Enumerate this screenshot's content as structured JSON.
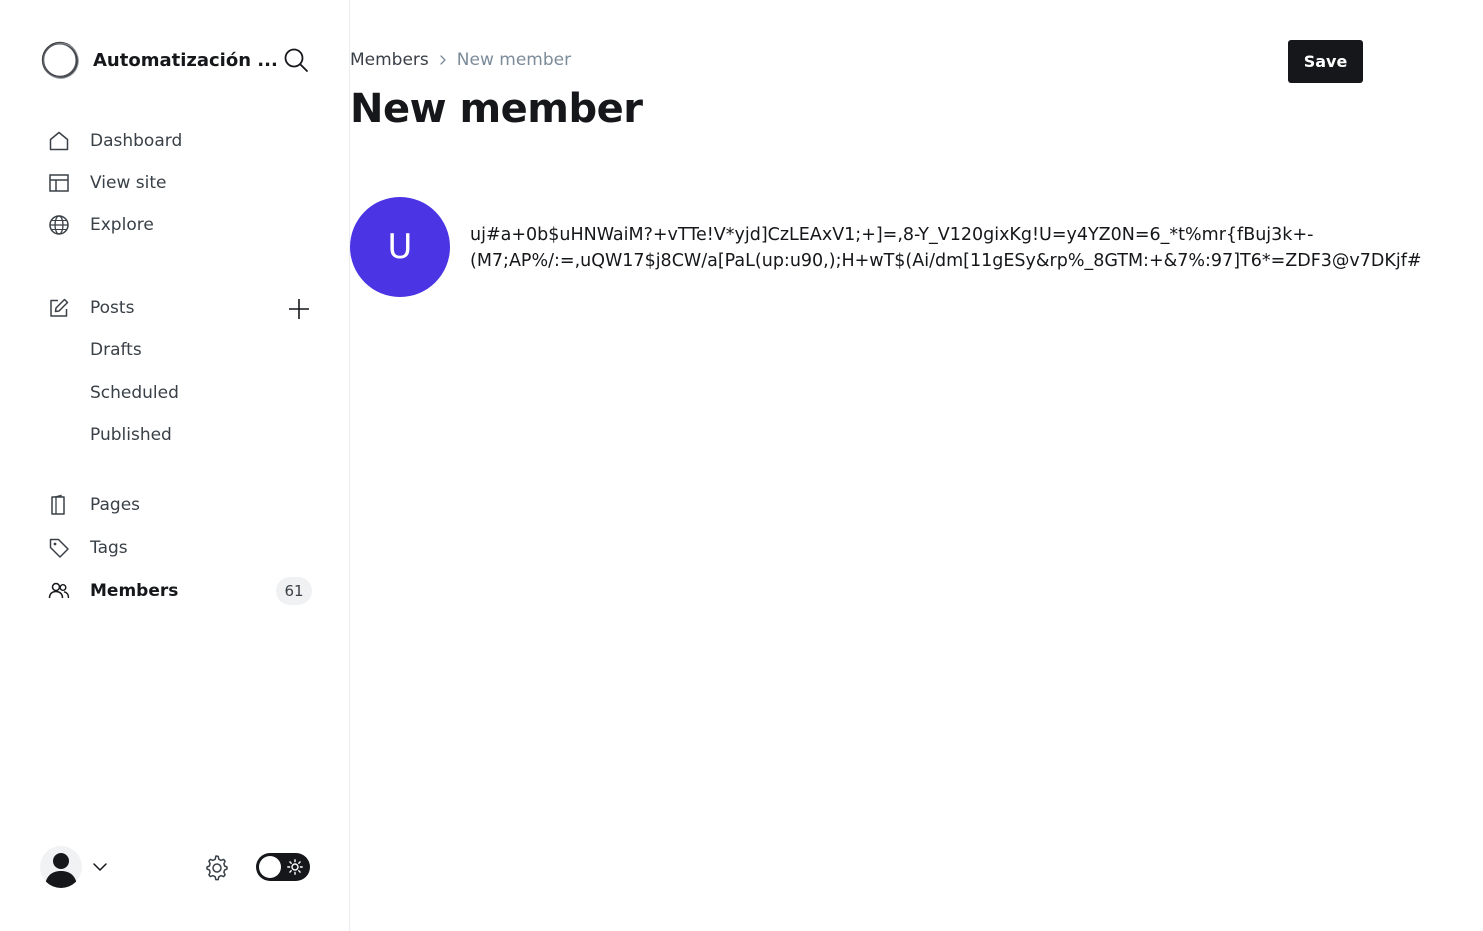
{
  "sidebar": {
    "brand": {
      "name": "Automatización ...",
      "logo_icon": "circle-logo-icon"
    },
    "search_icon": "search-icon",
    "nav": {
      "dashboard": {
        "label": "Dashboard",
        "icon": "home-icon"
      },
      "view_site": {
        "label": "View site",
        "icon": "layout-icon"
      },
      "explore": {
        "label": "Explore",
        "icon": "globe-icon"
      },
      "posts": {
        "label": "Posts",
        "icon": "edit-icon",
        "add_icon": "plus-icon"
      },
      "drafts": {
        "label": "Drafts"
      },
      "scheduled": {
        "label": "Scheduled"
      },
      "published": {
        "label": "Published"
      },
      "pages": {
        "label": "Pages",
        "icon": "page-icon"
      },
      "tags": {
        "label": "Tags",
        "icon": "tag-icon"
      },
      "members": {
        "label": "Members",
        "icon": "users-icon",
        "count": "61",
        "active": true
      }
    },
    "footer": {
      "avatar_icon": "user-avatar-icon",
      "chevron_icon": "chevron-down-icon",
      "settings_icon": "gear-icon",
      "theme_toggle_icon": "sun-icon"
    }
  },
  "header": {
    "breadcrumb": {
      "parent": "Members",
      "current": "New member"
    },
    "title": "New member",
    "save_label": "Save"
  },
  "member": {
    "initial": "U",
    "name_line1": "uj#a+0b$uHNWaiM?+vTTe!V*yjd]CzLEAxV1;+]=,8-Y_V120gixKg!U=y4YZ0N=6_*t%mr{fBuj3k+-",
    "name_line2": "(M7;AP%/:=,uQW17$j8CW/a[PaL(up:u90,);H+wT$(Ai/dm[11gESy&rp%_8GTM:+&7%:97]T6*=ZDF3@v7DKjf#"
  },
  "colors": {
    "accent": "#4b34e3",
    "primary_button": "#15171a",
    "muted_text": "#7c8b9a",
    "badge_bg": "#eff1f2"
  }
}
